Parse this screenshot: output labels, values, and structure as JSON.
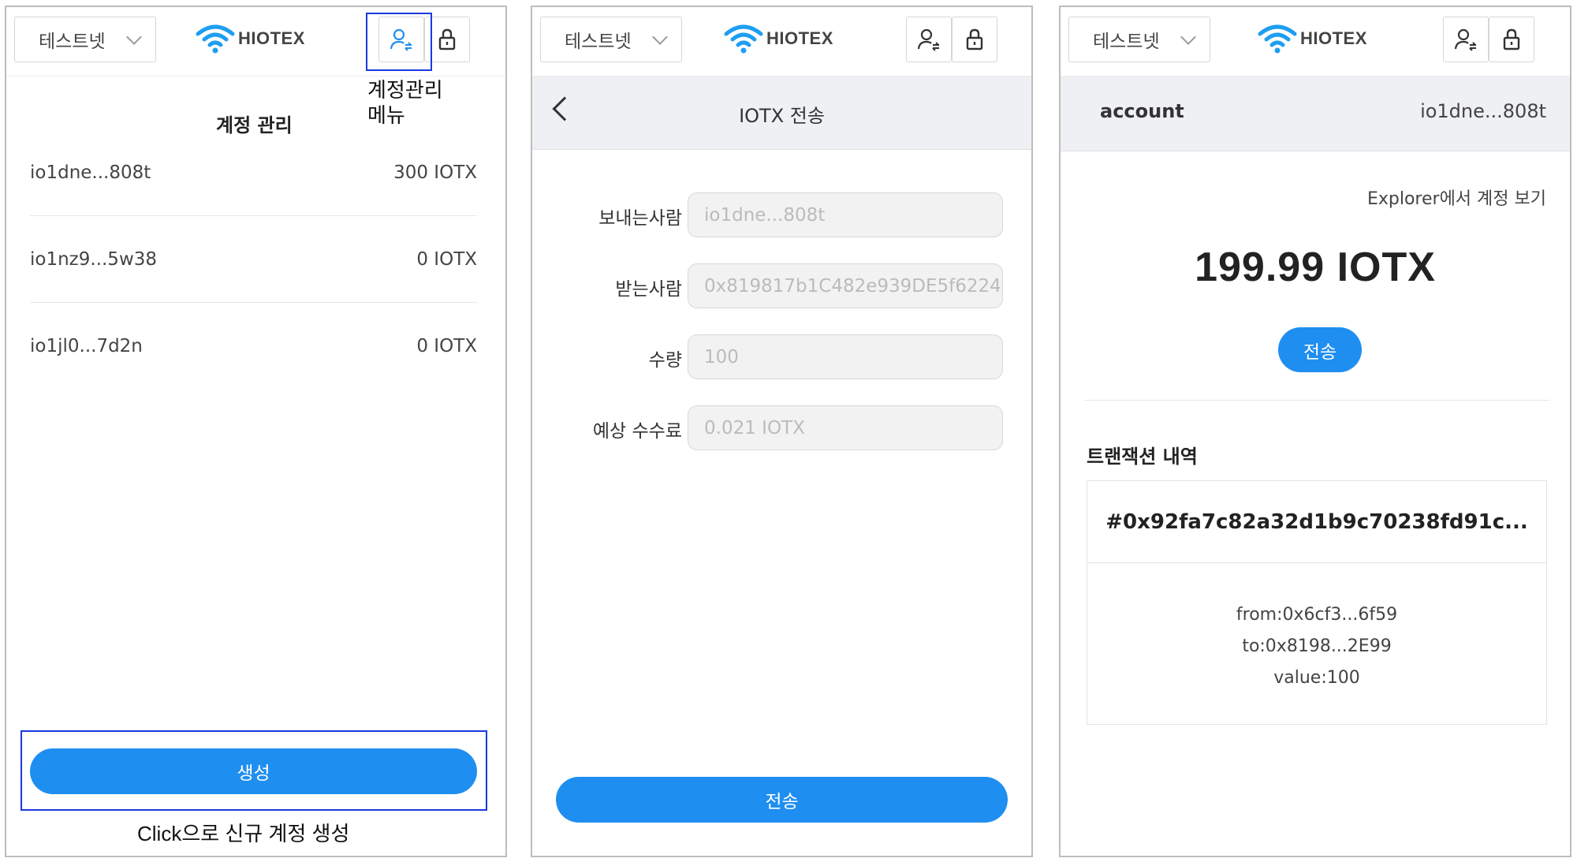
{
  "network_label": "테스트넷",
  "logo_text": "HIOTEX",
  "colors": {
    "accent": "#1f8ef1",
    "highlight": "#1b39e0",
    "subheader_bg": "#eef0f3"
  },
  "icons": [
    "wifi-logo-icon",
    "account-switch-icon",
    "lock-icon",
    "chevron-down-icon",
    "back-arrow-icon"
  ],
  "panel1": {
    "annotation_menu_line1": "계정관리",
    "annotation_menu_line2": "메뉴",
    "title": "계정 관리",
    "accounts": [
      {
        "address": "io1dne...808t",
        "balance": "300 IOTX"
      },
      {
        "address": "io1nz9...5w38",
        "balance": "0 IOTX"
      },
      {
        "address": "io1jl0...7d2n",
        "balance": "0 IOTX"
      }
    ],
    "create_button": "생성",
    "annotation_create": "Click으로 신규 계정 생성"
  },
  "panel2": {
    "title": "IOTX 전송",
    "fields": [
      {
        "label": "보내는사람",
        "value": "io1dne...808t"
      },
      {
        "label": "받는사람",
        "value": "0x819817b1C482e939DE5f6224"
      },
      {
        "label": "수량",
        "value": "100"
      },
      {
        "label": "예상 수수료",
        "value": "0.021 IOTX"
      }
    ],
    "send_button": "전송"
  },
  "panel3": {
    "account_label": "account",
    "account_address": "io1dne...808t",
    "explorer_link": "Explorer에서 계정 보기",
    "balance": "199.99 IOTX",
    "send_button": "전송",
    "tx_history_title": "트랜잭션 내역",
    "tx": {
      "hash": "#0x92fa7c82a32d1b9c70238fd91c...",
      "from": "from:0x6cf3...6f59",
      "to": "to:0x8198...2E99",
      "value": "value:100"
    }
  }
}
